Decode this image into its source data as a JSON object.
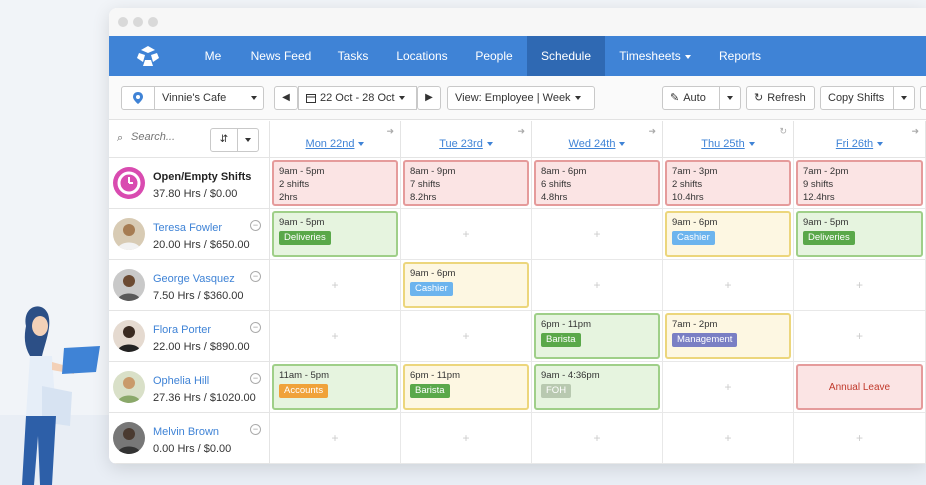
{
  "nav": {
    "items": [
      "Me",
      "News Feed",
      "Tasks",
      "Locations",
      "People",
      "Schedule",
      "Timesheets",
      "Reports"
    ],
    "active": "Schedule",
    "brand_color": "#3f83d6",
    "active_color": "#2f69b3"
  },
  "toolbar": {
    "location": "Vinnie's Cafe",
    "date_range": "22 Oct - 28 Oct",
    "view": "View: Employee | Week",
    "auto_label": "Auto",
    "refresh_label": "Refresh",
    "copy_shifts_label": "Copy Shifts"
  },
  "search": {
    "placeholder": "Search..."
  },
  "days": [
    "Mon 22nd",
    "Tue 23rd",
    "Wed 24th",
    "Thu 25th",
    "Fri 26th"
  ],
  "employees": [
    {
      "name": "Open/Empty Shifts",
      "stats": "37.80 Hrs / $0.00"
    },
    {
      "name": "Teresa Fowler",
      "stats": "20.00 Hrs / $650.00"
    },
    {
      "name": "George Vasquez",
      "stats": "7.50 Hrs / $360.00"
    },
    {
      "name": "Flora Porter",
      "stats": "22.00 Hrs / $890.00"
    },
    {
      "name": "Ophelia Hill",
      "stats": "27.36 Hrs / $1020.00"
    },
    {
      "name": "Melvin Brown",
      "stats": "0.00 Hrs / $0.00"
    }
  ],
  "open_shifts": [
    {
      "time": "9am - 5pm",
      "shifts": "2 shifts",
      "hours": "2hrs"
    },
    {
      "time": "8am - 9pm",
      "shifts": "7 shifts",
      "hours": "8.2hrs"
    },
    {
      "time": "8am - 6pm",
      "shifts": "6 shifts",
      "hours": "4.8hrs"
    },
    {
      "time": "7am - 3pm",
      "shifts": "2 shifts",
      "hours": "10.4hrs"
    },
    {
      "time": "7am - 2pm",
      "shifts": "9 shifts",
      "hours": "12.4hrs"
    }
  ],
  "shifts": {
    "teresa_mon": {
      "time": "9am - 5pm",
      "tag": "Deliveries"
    },
    "teresa_thu": {
      "time": "9am - 6pm",
      "tag": "Cashier"
    },
    "teresa_fri": {
      "time": "9am - 5pm",
      "tag": "Deliveries"
    },
    "george_tue": {
      "time": "9am - 6pm",
      "tag": "Cashier"
    },
    "flora_wed": {
      "time": "6pm - 11pm",
      "tag": "Barista"
    },
    "flora_thu": {
      "time": "7am - 2pm",
      "tag": "Management"
    },
    "ophelia_mon": {
      "time": "11am - 5pm",
      "tag": "Accounts"
    },
    "ophelia_tue": {
      "time": "6pm - 11pm",
      "tag": "Barista"
    },
    "ophelia_wed": {
      "time": "9am - 4:36pm",
      "tag": "FOH"
    },
    "ophelia_fri": {
      "leave": "Annual Leave"
    }
  },
  "tag_colors": {
    "Deliveries": "#5aa84a",
    "Cashier": "#6cb4ee",
    "Barista": "#5aa84a",
    "Management": "#7a7fc4",
    "Accounts": "#f0a23a",
    "FOH": "#b8c9b0"
  }
}
